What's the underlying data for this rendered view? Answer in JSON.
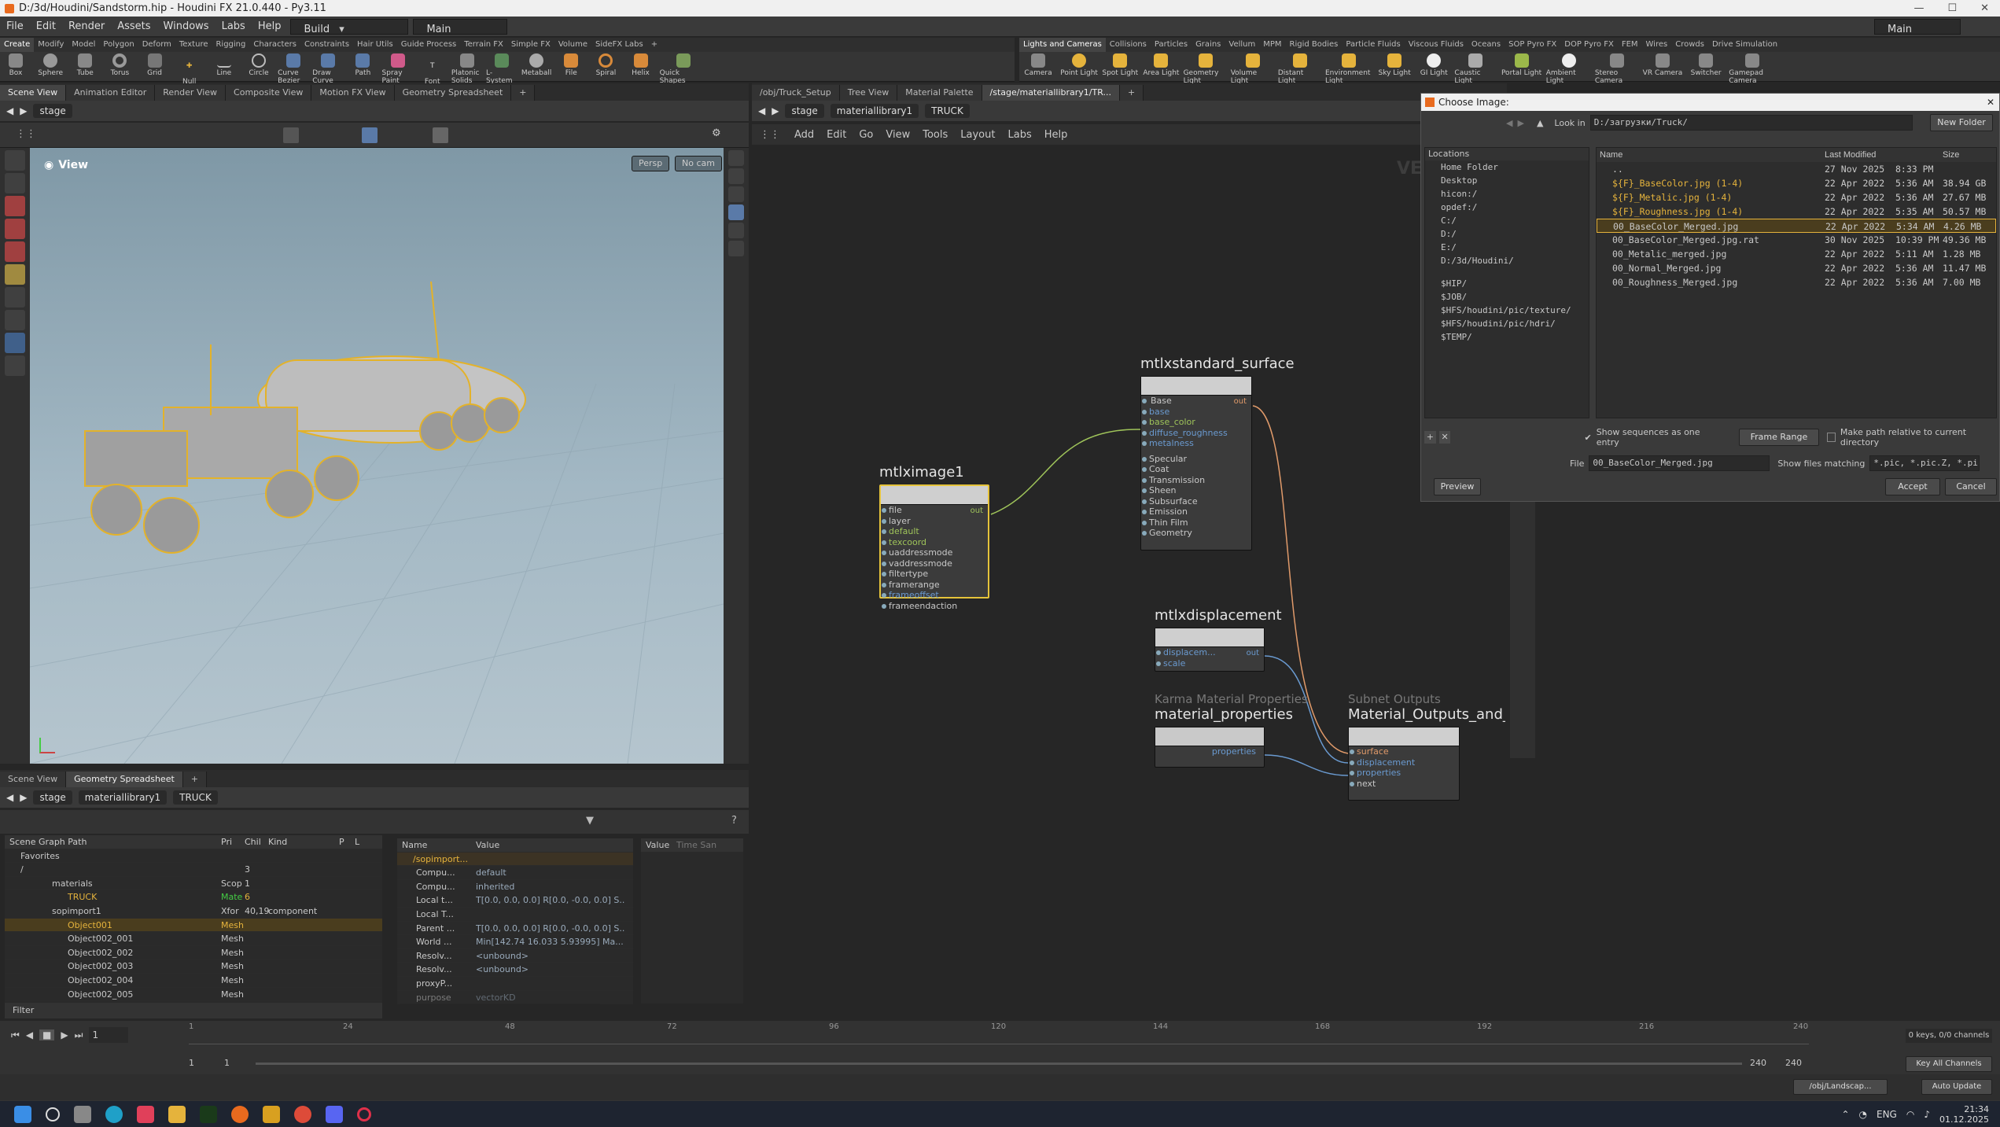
{
  "titlebar": {
    "title": "D:/3d/Houdini/Sandstorm.hip - Houdini FX 21.0.440 - Py3.11"
  },
  "menu": [
    "File",
    "Edit",
    "Render",
    "Assets",
    "Windows",
    "Labs",
    "Help"
  ],
  "desktop": "Build",
  "workspace": "Main",
  "right_workspace": "Main",
  "shelf_tabs_left": [
    "Create",
    "Modify",
    "Model",
    "Polygon",
    "Deform",
    "Texture",
    "Rigging",
    "Characters",
    "Constraints",
    "Hair Utils",
    "Guide Process",
    "Terrain FX",
    "Simple FX",
    "Volume",
    "SideFX Labs"
  ],
  "shelf_tools_left": [
    "Box",
    "Sphere",
    "Tube",
    "Torus",
    "Grid",
    "Null",
    "Line",
    "Circle",
    "Curve Bezier",
    "Draw Curve",
    "Path",
    "Spray Paint",
    "Font",
    "Platonic Solids",
    "L-System",
    "Metaball",
    "File",
    "Spiral",
    "Helix",
    "Quick Shapes"
  ],
  "shelf_tabs_right": [
    "Lights and Cameras",
    "Collisions",
    "Particles",
    "Grains",
    "Vellum",
    "MPM",
    "Rigid Bodies",
    "Particle Fluids",
    "Viscous Fluids",
    "Oceans",
    "SOP Pyro FX",
    "DOP Pyro FX",
    "FEM",
    "Wires",
    "Crowds",
    "Drive Simulation"
  ],
  "shelf_tools_right": [
    "Camera",
    "Point Light",
    "Spot Light",
    "Area Light",
    "Geometry Light",
    "Volume Light",
    "Distant Light",
    "Environment Light",
    "Sky Light",
    "GI Light",
    "Caustic Light",
    "Portal Light",
    "Ambient Light",
    "Stereo Camera",
    "VR Camera",
    "Switcher",
    "Gamepad Camera"
  ],
  "left_tabs": [
    "Scene View",
    "Animation Editor",
    "Render View",
    "Composite View",
    "Motion FX View",
    "Geometry Spreadsheet"
  ],
  "left_path": [
    "stage"
  ],
  "viewport": {
    "label": "View",
    "persp": "Persp",
    "cam": "No cam"
  },
  "lower_tabs": [
    "Scene View",
    "Geometry Spreadsheet"
  ],
  "lower_path": [
    "stage",
    "materiallibrary1",
    "TRUCK"
  ],
  "scene_graph": {
    "headers": [
      "Scene Graph Path",
      "Pri",
      "Chil",
      "Kind",
      "P",
      "L"
    ],
    "rows": [
      {
        "name": "Favorites",
        "pri": "",
        "chil": "",
        "kind": ""
      },
      {
        "name": "/",
        "pri": "",
        "chil": "3",
        "kind": ""
      },
      {
        "name": "materials",
        "pri": "Scop",
        "chil": "1",
        "kind": ""
      },
      {
        "name": "TRUCK",
        "pri": "Mate",
        "chil": "6",
        "kind": ""
      },
      {
        "name": "sopimport1",
        "pri": "Xfor",
        "chil": "40,19",
        "kind": "component"
      },
      {
        "name": "Object001",
        "pri": "Mesh",
        "chil": "",
        "kind": ""
      },
      {
        "name": "Object002_001",
        "pri": "Mesh",
        "chil": "",
        "kind": ""
      },
      {
        "name": "Object002_002",
        "pri": "Mesh",
        "chil": "",
        "kind": ""
      },
      {
        "name": "Object002_003",
        "pri": "Mesh",
        "chil": "",
        "kind": ""
      },
      {
        "name": "Object002_004",
        "pri": "Mesh",
        "chil": "",
        "kind": ""
      },
      {
        "name": "Object002_005",
        "pri": "Mesh",
        "chil": "",
        "kind": ""
      }
    ],
    "filter": "Filter"
  },
  "props": {
    "headers": [
      "Name",
      "Value"
    ],
    "root": "/sopimport...",
    "rows": [
      {
        "name": "Compu...",
        "value": "default"
      },
      {
        "name": "Compu...",
        "value": "inherited"
      },
      {
        "name": "Local t...",
        "value": "T[0.0, 0.0, 0.0] R[0.0, -0.0, 0.0] S..."
      },
      {
        "name": "Local T...",
        "value": ""
      },
      {
        "name": "Parent ...",
        "value": "T[0.0, 0.0, 0.0] R[0.0, -0.0, 0.0] S..."
      },
      {
        "name": "World ...",
        "value": "Min[142.74 16.033 5.93995] Ma..."
      },
      {
        "name": "Resolv...",
        "value": "<unbound>"
      },
      {
        "name": "Resolv...",
        "value": "<unbound>"
      },
      {
        "name": "proxyP...",
        "value": ""
      },
      {
        "name": "purpose",
        "value": "vectorKD"
      }
    ],
    "value_header": "Value",
    "time_header": "Time San"
  },
  "net_tabs": [
    "/obj/Truck_Setup",
    "Tree View",
    "Material Palette",
    "/stage/materiallibrary1/TR..."
  ],
  "net_path": [
    "stage",
    "materiallibrary1",
    "TRUCK"
  ],
  "net_menu": [
    "Add",
    "Edit",
    "Go",
    "View",
    "Tools",
    "Layout",
    "Labs",
    "Help"
  ],
  "nodes": {
    "image": {
      "title": "mtlximage1",
      "params": [
        "file",
        "layer",
        "default",
        "texcoord",
        "uaddressmode",
        "vaddressmode",
        "filtertype",
        "framerange",
        "frameoffset",
        "frameendaction"
      ],
      "out": "out"
    },
    "surface": {
      "title": "mtlxstandard_surface",
      "base": "Base",
      "params": [
        "base",
        "base_color",
        "diffuse_roughness",
        "metalness"
      ],
      "groups": [
        "Specular",
        "Coat",
        "Transmission",
        "Sheen",
        "Subsurface",
        "Emission",
        "Thin Film",
        "Geometry"
      ],
      "out": "out"
    },
    "disp": {
      "title": "mtlxdisplacement",
      "params": [
        "displacem...",
        "scale"
      ],
      "out": "out"
    },
    "matprops": {
      "subtitle": "Karma Material Properties",
      "title": "material_properties",
      "out": "properties"
    },
    "outputs": {
      "subtitle": "Subnet Outputs",
      "title": "Material_Outputs_and_AOVs",
      "params": [
        "surface",
        "displacement",
        "properties",
        "next"
      ]
    }
  },
  "net_watermark": "VE",
  "dialog": {
    "title": "Choose Image:",
    "look_in_label": "Look in",
    "look_in": "D:/загрузки/Truck/",
    "new_folder": "New Folder",
    "locations_header": "Locations",
    "locations": [
      "Home Folder",
      "Desktop",
      "hicon:/",
      "opdef:/",
      "C:/",
      "D:/",
      "E:/",
      "D:/3d/Houdini/"
    ],
    "vars": [
      "$HIP/",
      "$JOB/",
      "$HFS/houdini/pic/texture/",
      "$HFS/houdini/pic/hdri/",
      "$TEMP/"
    ],
    "col_headers": [
      "Name",
      "Last Modified",
      "Size"
    ],
    "files": [
      {
        "name": "..",
        "date": "27 Nov 2025",
        "time": "8:33 PM",
        "size": ""
      },
      {
        "name": "${F}_BaseColor.jpg (1-4)",
        "date": "22 Apr 2022",
        "time": "5:36 AM",
        "size": "38.94 GB"
      },
      {
        "name": "${F}_Metalic.jpg (1-4)",
        "date": "22 Apr 2022",
        "time": "5:36 AM",
        "size": "27.67 MB"
      },
      {
        "name": "${F}_Roughness.jpg (1-4)",
        "date": "22 Apr 2022",
        "time": "5:35 AM",
        "size": "50.57 MB"
      },
      {
        "name": "00_BaseColor_Merged.jpg",
        "date": "22 Apr 2022",
        "time": "5:34 AM",
        "size": "4.26 MB"
      },
      {
        "name": "00_BaseColor_Merged.jpg.rat",
        "date": "30 Nov 2025",
        "time": "10:39 PM",
        "size": "49.36 MB"
      },
      {
        "name": "00_Metalic_merged.jpg",
        "date": "22 Apr 2022",
        "time": "5:11 AM",
        "size": "1.28 MB"
      },
      {
        "name": "00_Normal_Merged.jpg",
        "date": "22 Apr 2022",
        "time": "5:36 AM",
        "size": "11.47 MB"
      },
      {
        "name": "00_Roughness_Merged.jpg",
        "date": "22 Apr 2022",
        "time": "5:36 AM",
        "size": "7.00 MB"
      }
    ],
    "show_sequences": "Show sequences as one entry",
    "frame_range": "Frame Range",
    "make_relative": "Make path relative to current directory",
    "file_label": "File",
    "file_value": "00_BaseColor_Merged.jpg",
    "match_label": "Show files matching",
    "match_value": "*.pic, *.pic.Z, *.picZ, ...",
    "preview": "Preview",
    "accept": "Accept",
    "cancel": "Cancel"
  },
  "timeline": {
    "frame": "1",
    "ticks": [
      "1",
      "24",
      "48",
      "72",
      "96",
      "120",
      "144",
      "168",
      "192",
      "216",
      "240"
    ],
    "start": "1",
    "start2": "1",
    "end": "240",
    "end2": "240",
    "keys": "0 keys, 0/0 channels",
    "key_all": "Key All Channels",
    "auto": "Auto Update",
    "status_path": "/obj/Landscap..."
  },
  "taskbar": {
    "lang": "ENG",
    "time": "21:34",
    "date": "01.12.2025"
  }
}
